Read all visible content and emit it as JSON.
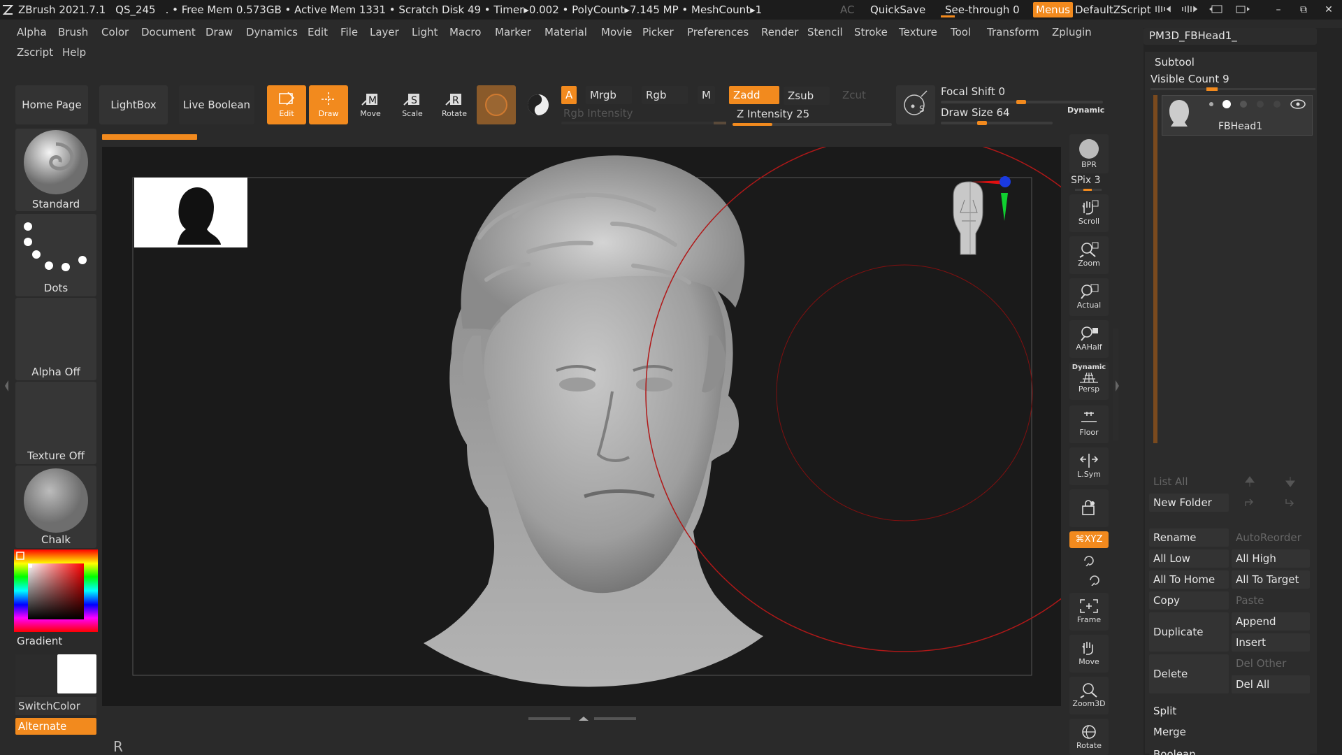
{
  "titlebar": {
    "app": "ZBrush 2021.7.1",
    "qs": "QS_245",
    "stats": ". • Free Mem 0.573GB • Active Mem 1331 • Scratch Disk 49 • Timer▸0.002 • PolyCount▸7.145 MP  • MeshCount▸1",
    "ac": "AC",
    "quicksave": "QuickSave",
    "seethrough": "See-through  0",
    "menus": "Menus",
    "script": "DefaultZScript",
    "minimize": "–",
    "restore": "⧉",
    "close": "✕"
  },
  "menubar": {
    "row1": [
      "Alpha",
      "Brush",
      "Color",
      "Document",
      "Draw",
      "Dynamics",
      "Edit",
      "File",
      "Layer",
      "Light",
      "Macro",
      "Marker",
      "Material",
      "Movie",
      "Picker",
      "Preferences",
      "Render",
      "Stencil",
      "Stroke",
      "Texture",
      "Tool",
      "Transform",
      "Zplugin"
    ],
    "row2": [
      "Zscript",
      "Help"
    ]
  },
  "shelf": {
    "home_page": "Home Page",
    "lightbox": "LightBox",
    "live_boolean": "Live Boolean",
    "edit": "Edit",
    "draw": "Draw",
    "move": "Move",
    "scale": "Scale",
    "rotate": "Rotate",
    "a": "A",
    "mrgb": "Mrgb",
    "rgb": "Rgb",
    "m": "M",
    "rgb_intensity": "Rgb Intensity",
    "zadd": "Zadd",
    "zsub": "Zsub",
    "zcut": "Zcut",
    "z_intensity": "Z Intensity 25",
    "z_intensity_value": 25,
    "focal_shift": "Focal Shift 0",
    "focal_shift_value": 0,
    "draw_size": "Draw Size 64",
    "draw_size_value": 64,
    "dynamic": "Dynamic"
  },
  "lefttray": {
    "brush": "Standard",
    "stroke": "Dots",
    "alpha": "Alpha Off",
    "texture": "Texture Off",
    "material": "Chalk",
    "gradient": "Gradient",
    "switchcolor": "SwitchColor",
    "alternate": "Alternate"
  },
  "rightshelf": {
    "bpr": "BPR",
    "spix": "SPix 3",
    "scroll": "Scroll",
    "zoom": "Zoom",
    "actual": "Actual",
    "aahalf": "AAHalf",
    "dynamic": "Dynamic",
    "persp": "Persp",
    "floor": "Floor",
    "lsym": "L.Sym",
    "xyz": "⌘XYZ",
    "frame": "Frame",
    "move": "Move",
    "zoom3d": "Zoom3D",
    "rotate": "Rotate"
  },
  "rightpanel": {
    "tool_name": "PM3D_FBHead1_",
    "subtool": "Subtool",
    "visible_count": "Visible Count 9",
    "subtool_item": "FBHead1",
    "list_all": "List All",
    "new_folder": "New Folder",
    "rename": "Rename",
    "autoreorder": "AutoReorder",
    "all_low": "All Low",
    "all_high": "All High",
    "all_to_home": "All To Home",
    "all_to_target": "All To Target",
    "copy": "Copy",
    "paste": "Paste",
    "duplicate": "Duplicate",
    "append": "Append",
    "insert": "Insert",
    "delete": "Delete",
    "del_other": "Del Other",
    "del_all": "Del All",
    "split": "Split",
    "merge": "Merge",
    "boolean": "Boolean"
  },
  "canvas": {
    "status": "R"
  },
  "colors": {
    "accent": "#f28a1e",
    "background": "#2a2a2a",
    "viewport": "#1a1a1a",
    "brush_circle": "#c02020"
  }
}
